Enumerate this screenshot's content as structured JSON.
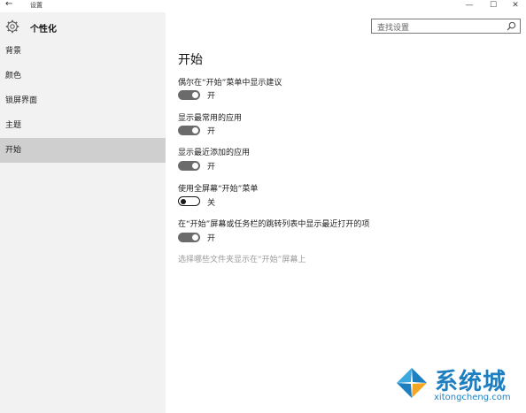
{
  "window": {
    "back_glyph": "←",
    "title": "设置",
    "minimize_glyph": "—",
    "maximize_glyph": "☐",
    "close_glyph": "✕"
  },
  "header": {
    "app_title": "个性化",
    "icon": "gear-icon"
  },
  "search": {
    "placeholder": "查找设置",
    "icon": "search-icon"
  },
  "sidebar": {
    "items": [
      {
        "label": "背景",
        "selected": false
      },
      {
        "label": "颜色",
        "selected": false
      },
      {
        "label": "锁屏界面",
        "selected": false
      },
      {
        "label": "主题",
        "selected": false
      },
      {
        "label": "开始",
        "selected": true
      }
    ]
  },
  "main": {
    "title": "开始",
    "settings": [
      {
        "label": "偶尔在“开始”菜单中显示建议",
        "state": "开",
        "on": true
      },
      {
        "label": "显示最常用的应用",
        "state": "开",
        "on": true
      },
      {
        "label": "显示最近添加的应用",
        "state": "开",
        "on": true
      },
      {
        "label": "使用全屏幕“开始”菜单",
        "state": "关",
        "on": false
      },
      {
        "label": "在“开始”屏幕或任务栏的跳转列表中显示最近打开的项",
        "state": "开",
        "on": true
      }
    ],
    "link": "选择哪些文件夹显示在“开始”屏幕上"
  },
  "watermark": {
    "cn": "系统城",
    "en": "xitongcheng.com"
  },
  "colors": {
    "accent": "#1e7fc0",
    "toggle_on": "#6b6b6b",
    "sidebar_bg": "#f2f2f2",
    "selected_bg": "#cfcfcf"
  }
}
